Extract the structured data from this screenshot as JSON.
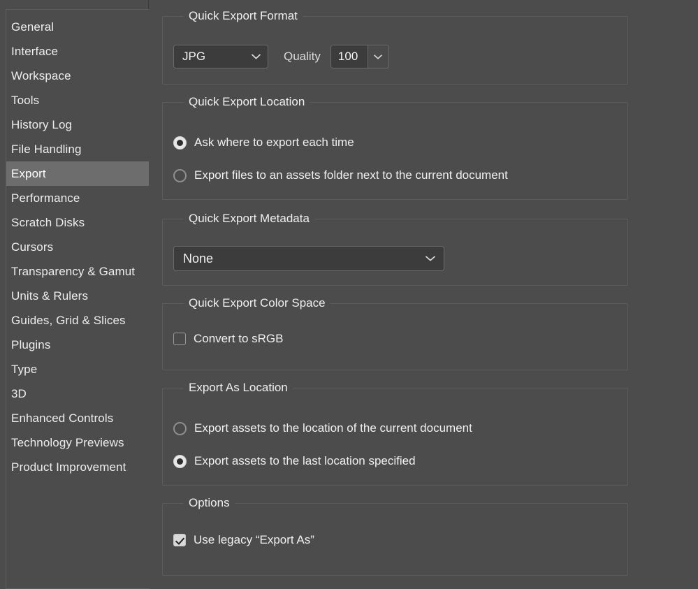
{
  "sidebar": {
    "items": [
      {
        "label": "General",
        "selected": false
      },
      {
        "label": "Interface",
        "selected": false
      },
      {
        "label": "Workspace",
        "selected": false
      },
      {
        "label": "Tools",
        "selected": false
      },
      {
        "label": "History Log",
        "selected": false
      },
      {
        "label": "File Handling",
        "selected": false
      },
      {
        "label": "Export",
        "selected": true
      },
      {
        "label": "Performance",
        "selected": false
      },
      {
        "label": "Scratch Disks",
        "selected": false
      },
      {
        "label": "Cursors",
        "selected": false
      },
      {
        "label": "Transparency & Gamut",
        "selected": false
      },
      {
        "label": "Units & Rulers",
        "selected": false
      },
      {
        "label": "Guides, Grid & Slices",
        "selected": false
      },
      {
        "label": "Plugins",
        "selected": false
      },
      {
        "label": "Type",
        "selected": false
      },
      {
        "label": "3D",
        "selected": false
      },
      {
        "label": "Enhanced Controls",
        "selected": false
      },
      {
        "label": "Technology Previews",
        "selected": false
      },
      {
        "label": "Product Improvement",
        "selected": false
      }
    ]
  },
  "groups": {
    "quick_export_format": {
      "legend": "Quick Export Format",
      "format_value": "JPG",
      "quality_label": "Quality",
      "quality_value": "100"
    },
    "quick_export_location": {
      "legend": "Quick Export Location",
      "option_1": "Ask where to export each time",
      "option_2": "Export files to an assets folder next to the current document"
    },
    "quick_export_metadata": {
      "legend": "Quick Export Metadata",
      "metadata_value": "None"
    },
    "quick_export_color_space": {
      "legend": "Quick Export Color Space",
      "convert_srgb_label": "Convert to sRGB"
    },
    "export_as_location": {
      "legend": "Export As Location",
      "option_1": "Export assets to the location of the current document",
      "option_2": "Export assets to the last location specified"
    },
    "options": {
      "legend": "Options",
      "use_legacy_label": "Use legacy “Export As”"
    }
  },
  "colors": {
    "window_background": "#4c4c4c",
    "field_background": "#3c3c3c",
    "selection_highlight": "#6d6d6d",
    "border": "#5c5c5c",
    "text": "#f0f0f0"
  }
}
